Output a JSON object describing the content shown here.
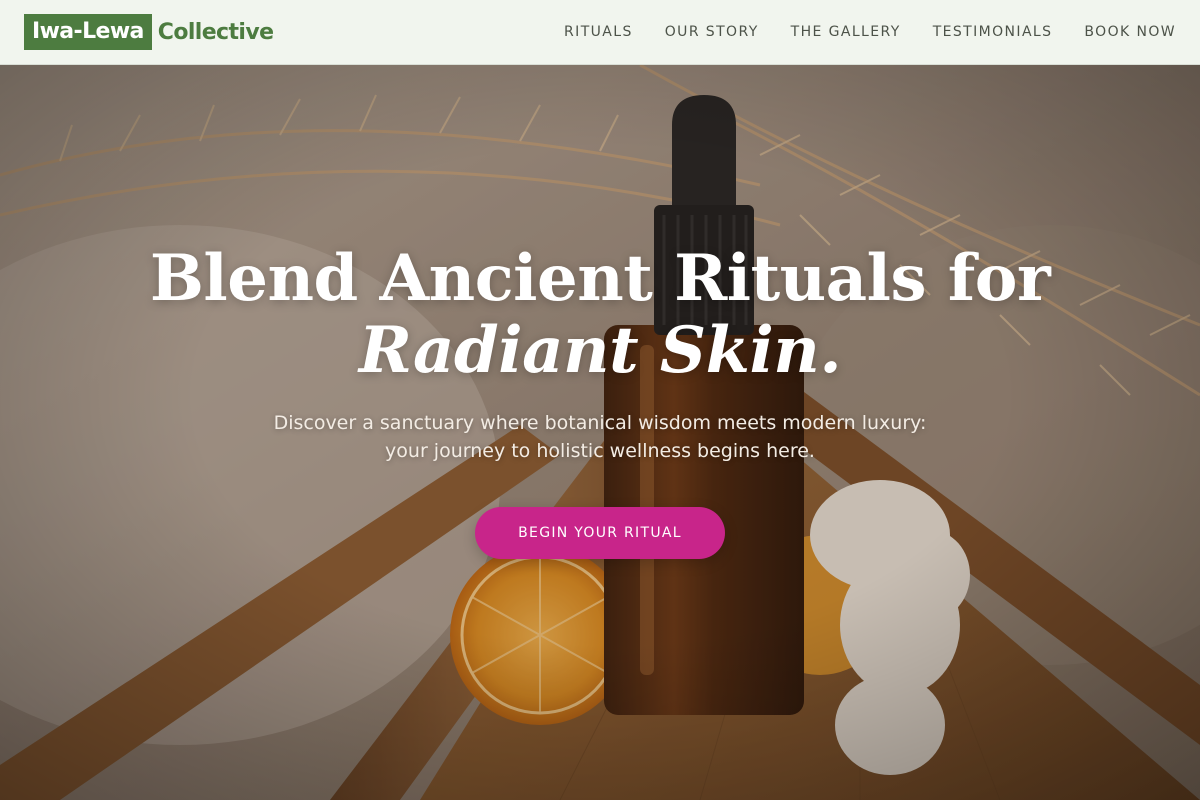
{
  "brand": {
    "logo_box": "Iwa-Lewa",
    "logo_text": "Collective"
  },
  "nav": [
    {
      "label": "RITUALS"
    },
    {
      "label": "OUR STORY"
    },
    {
      "label": "THE GALLERY"
    },
    {
      "label": "TESTIMONIALS"
    },
    {
      "label": "BOOK NOW"
    }
  ],
  "hero": {
    "headline_line1": "Blend Ancient Rituals for",
    "headline_line2": "Radiant Skin.",
    "subtitle": "Discover a sanctuary where botanical wisdom meets modern luxury: your journey to holistic wellness begins here.",
    "cta_label": "BEGIN YOUR RITUAL"
  },
  "colors": {
    "brand_green": "#4d7c40",
    "header_bg": "#f1f5ee",
    "cta_magenta": "#c8258a",
    "nav_text": "#4d5349"
  }
}
